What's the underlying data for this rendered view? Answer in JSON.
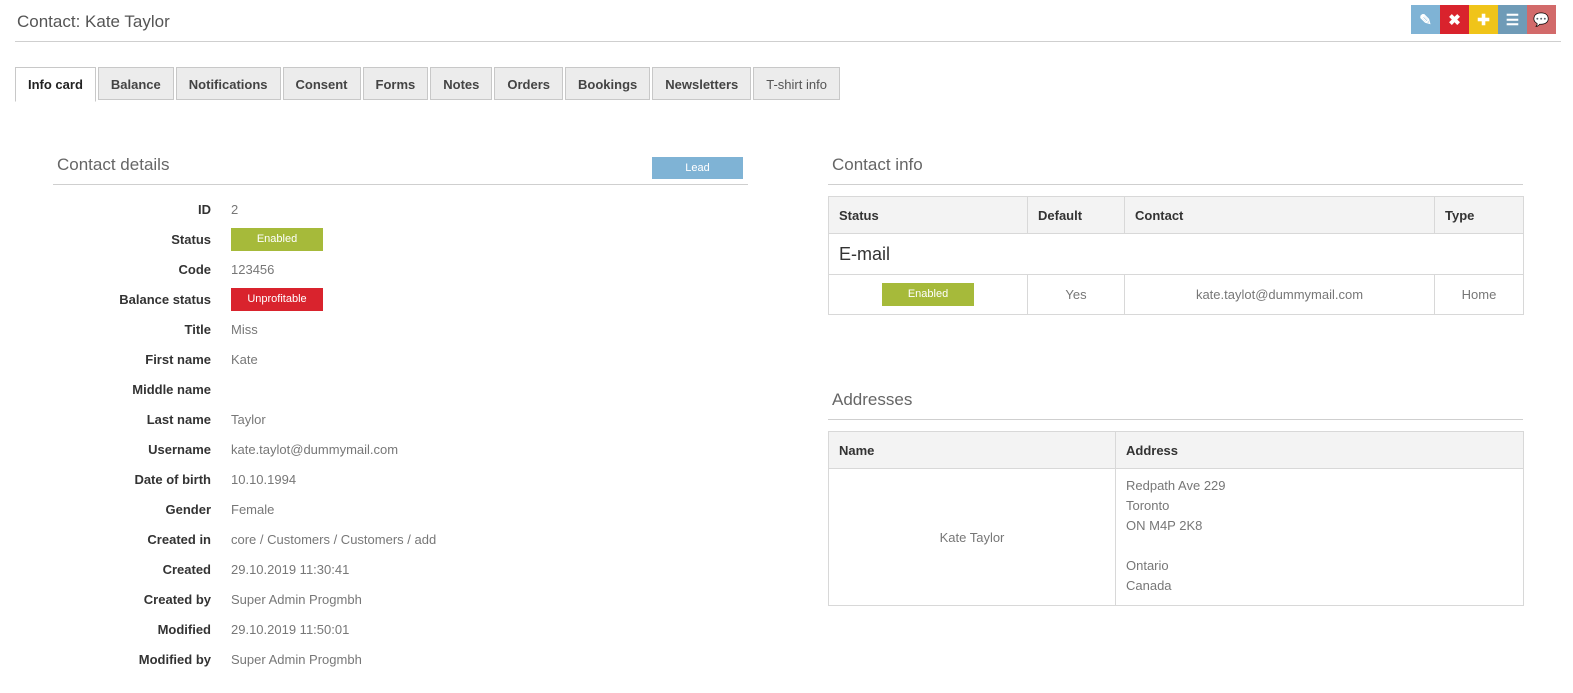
{
  "header": {
    "title": "Contact: Kate Taylor"
  },
  "toolbar": {
    "buttons": [
      {
        "name": "edit-icon",
        "glyph": "✎",
        "color": "#7fb3d5"
      },
      {
        "name": "close-icon",
        "glyph": "✖",
        "color": "#d9232d"
      },
      {
        "name": "add-icon",
        "glyph": "✚",
        "color": "#f0c419"
      },
      {
        "name": "menu-icon",
        "glyph": "☰",
        "color": "#6f9bb7"
      },
      {
        "name": "chat-icon",
        "glyph": "💬",
        "color": "#d26a6a"
      }
    ]
  },
  "tabs": [
    {
      "label": "Info card",
      "active": true
    },
    {
      "label": "Balance"
    },
    {
      "label": "Notifications"
    },
    {
      "label": "Consent"
    },
    {
      "label": "Forms"
    },
    {
      "label": "Notes"
    },
    {
      "label": "Orders"
    },
    {
      "label": "Bookings"
    },
    {
      "label": "Newsletters"
    },
    {
      "label": "T-shirt info"
    }
  ],
  "contact_details": {
    "title": "Contact details",
    "lead_badge": "Lead",
    "fields": {
      "id": {
        "label": "ID",
        "value": "2"
      },
      "status": {
        "label": "Status",
        "value": "Enabled"
      },
      "code": {
        "label": "Code",
        "value": "123456"
      },
      "balance_status": {
        "label": "Balance status",
        "value": "Unprofitable"
      },
      "title": {
        "label": "Title",
        "value": "Miss"
      },
      "first_name": {
        "label": "First name",
        "value": "Kate"
      },
      "middle_name": {
        "label": "Middle name",
        "value": ""
      },
      "last_name": {
        "label": "Last name",
        "value": "Taylor"
      },
      "username": {
        "label": "Username",
        "value": "kate.taylot@dummymail.com"
      },
      "date_of_birth": {
        "label": "Date of birth",
        "value": "10.10.1994"
      },
      "gender": {
        "label": "Gender",
        "value": "Female"
      },
      "created_in": {
        "label": "Created in",
        "value": "core / Customers / Customers / add"
      },
      "created": {
        "label": "Created",
        "value": "29.10.2019 11:30:41"
      },
      "created_by": {
        "label": "Created by",
        "value": "Super Admin Progmbh"
      },
      "modified": {
        "label": "Modified",
        "value": "29.10.2019 11:50:01"
      },
      "modified_by": {
        "label": "Modified by",
        "value": "Super Admin Progmbh"
      }
    }
  },
  "contact_info": {
    "title": "Contact info",
    "columns": [
      "Status",
      "Default",
      "Contact",
      "Type"
    ],
    "group": "E-mail",
    "row": {
      "status": "Enabled",
      "default": "Yes",
      "contact": "kate.taylot@dummymail.com",
      "type": "Home"
    }
  },
  "addresses": {
    "title": "Addresses",
    "columns": [
      "Name",
      "Address"
    ],
    "row": {
      "name": "Kate Taylor",
      "lines": [
        "Redpath Ave 229",
        "Toronto",
        "ON M4P 2K8",
        "",
        "Ontario",
        "Canada"
      ]
    }
  },
  "colors": {
    "enabled": "#a6ba3a",
    "unprofitable": "#d9232d",
    "lead": "#7fb3d5"
  }
}
